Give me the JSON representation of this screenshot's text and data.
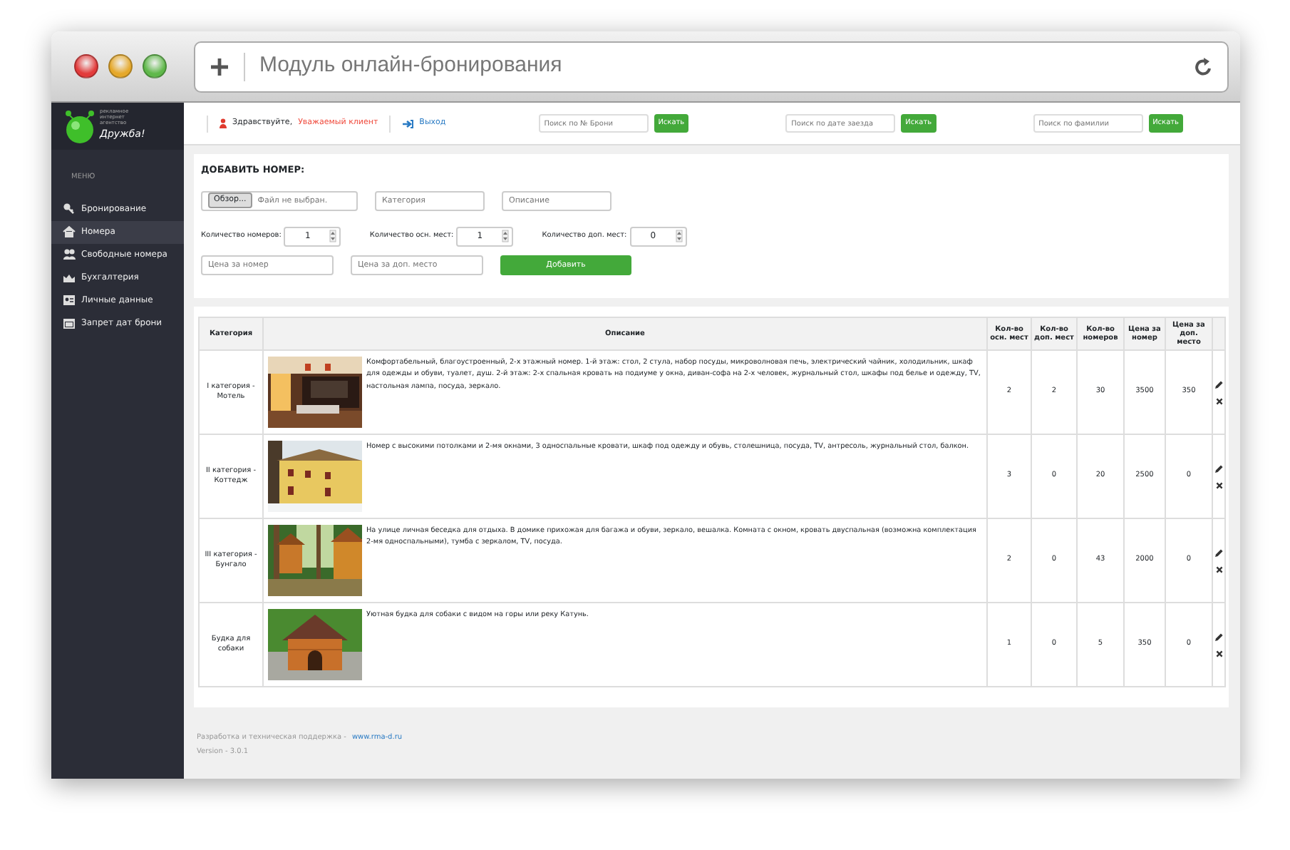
{
  "window": {
    "title": "Модуль онлайн-бронирования"
  },
  "logo": {
    "tagline": "рекламное интернет агентство",
    "name": "Дружба!"
  },
  "sidebar": {
    "heading": "МЕНЮ",
    "items": [
      {
        "label": "Бронирование",
        "selected": false
      },
      {
        "label": "Номера",
        "selected": true
      },
      {
        "label": "Свободные номера",
        "selected": false
      },
      {
        "label": "Бухгалтерия",
        "selected": false
      },
      {
        "label": "Личные данные",
        "selected": false
      },
      {
        "label": "Запрет дат брони",
        "selected": false
      }
    ]
  },
  "topbar": {
    "greeting": "Здравствуйте,",
    "user": "Уважаемый клиент",
    "logout": "Выход",
    "searches": [
      {
        "placeholder": "Поиск по № Брони",
        "button": "Искать"
      },
      {
        "placeholder": "Поиск по дате заезда",
        "button": "Искать"
      },
      {
        "placeholder": "Поиск по фамилии",
        "button": "Искать"
      }
    ]
  },
  "form": {
    "title": "ДОБАВИТЬ НОМЕР:",
    "file_button": "Обзор...",
    "file_status": "Файл не выбран.",
    "category_placeholder": "Категория",
    "description_placeholder": "Описание",
    "counters": [
      {
        "label": "Количество номеров:",
        "value": "1"
      },
      {
        "label": "Количество осн. мест:",
        "value": "1"
      },
      {
        "label": "Количество доп. мест:",
        "value": "0"
      }
    ],
    "price_placeholder": "Цена за номер",
    "extra_price_placeholder": "Цена за доп. место",
    "submit": "Добавить"
  },
  "table": {
    "columns": [
      "Категория",
      "Описание",
      "Кол-во осн. мест",
      "Кол-во доп. мест",
      "Кол-во номеров",
      "Цена за номер",
      "Цена за доп. место"
    ],
    "rows": [
      {
        "category": "I категория - Мотель",
        "description": "Комфортабельный, благоустроенный, 2-х этажный номер. 1-й этаж: стол, 2 стула, набор посуды, микроволновая печь, электрический чайник, холодильник, шкаф для одежды и обуви, туалет, душ. 2-й этаж: 2-х спальная кровать на подиуме у окна, диван-софа на 2-х человек, журнальный стол, шкафы под белье и одежду, TV, настольная лампа, посуда, зеркало.",
        "values": [
          "2",
          "2",
          "30",
          "3500",
          "350"
        ]
      },
      {
        "category": "II категория - Коттедж",
        "description": "Номер с высокими потолками и 2-мя окнами, 3 односпальные кровати, шкаф под одежду и обувь, столешница, посуда, TV, антресоль, журнальный стол, балкон.",
        "values": [
          "3",
          "0",
          "20",
          "2500",
          "0"
        ]
      },
      {
        "category": "III категория - Бунгало",
        "description": "На улице личная беседка для отдыха. В домике прихожая для багажа и обуви, зеркало, вешалка. Комната с окном, кровать двуспальная (возможна комплектация 2-мя односпальными), тумба с зеркалом, TV, посуда.",
        "values": [
          "2",
          "0",
          "43",
          "2000",
          "0"
        ]
      },
      {
        "category": "Будка для собаки",
        "description": "Уютная будка для собаки с видом на горы или реку Катунь.",
        "values": [
          "1",
          "0",
          "5",
          "350",
          "0"
        ]
      }
    ]
  },
  "footer": {
    "text": "Разработка и техническая поддержка -",
    "link": "www.rma-d.ru",
    "version": "Version - 3.0.1"
  }
}
